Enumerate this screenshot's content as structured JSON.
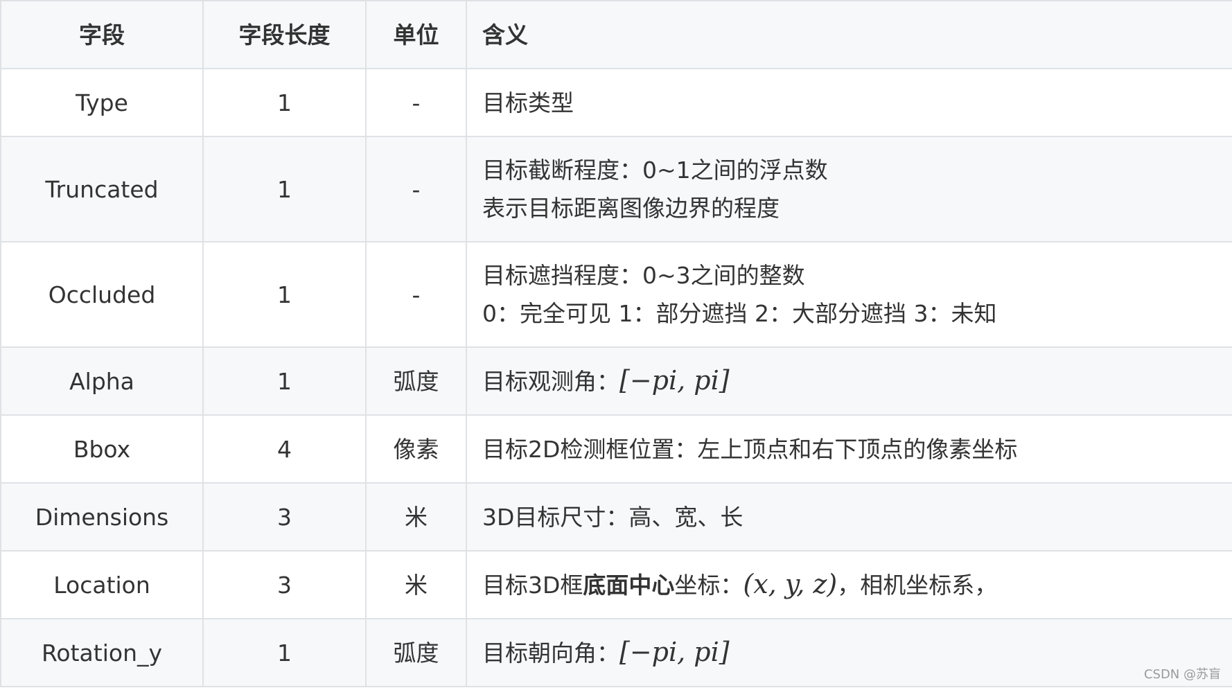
{
  "header": {
    "field": "字段",
    "length": "字段长度",
    "unit": "单位",
    "meaning": "含义"
  },
  "rows": [
    {
      "field": "Type",
      "length": "1",
      "unit": "-",
      "meaning_line1": "目标类型"
    },
    {
      "field": "Truncated",
      "length": "1",
      "unit": "-",
      "meaning_line1": "目标截断程度：0~1之间的浮点数",
      "meaning_line2": "表示目标距离图像边界的程度"
    },
    {
      "field": "Occluded",
      "length": "1",
      "unit": "-",
      "meaning_line1": "目标遮挡程度：0~3之间的整数",
      "meaning_line2": "0：完全可见 1：部分遮挡 2：大部分遮挡 3：未知"
    },
    {
      "field": "Alpha",
      "length": "1",
      "unit": "弧度",
      "meaning_prefix": "目标观测角：",
      "meaning_math": "[−pi, pi]"
    },
    {
      "field": "Bbox",
      "length": "4",
      "unit": "像素",
      "meaning_line1": "目标2D检测框位置：左上顶点和右下顶点的像素坐标"
    },
    {
      "field": "Dimensions",
      "length": "3",
      "unit": "米",
      "meaning_line1": "3D目标尺寸：高、宽、长"
    },
    {
      "field": "Location",
      "length": "3",
      "unit": "米",
      "meaning_prefix": "目标3D框",
      "meaning_bold": "底面中心",
      "meaning_mid": "坐标：",
      "meaning_math": "(x, y, z)",
      "meaning_suffix": "，相机坐标系，"
    },
    {
      "field": "Rotation_y",
      "length": "1",
      "unit": "弧度",
      "meaning_prefix": "目标朝向角：",
      "meaning_math": "[−pi, pi]"
    }
  ],
  "watermark": "CSDN @苏盲"
}
